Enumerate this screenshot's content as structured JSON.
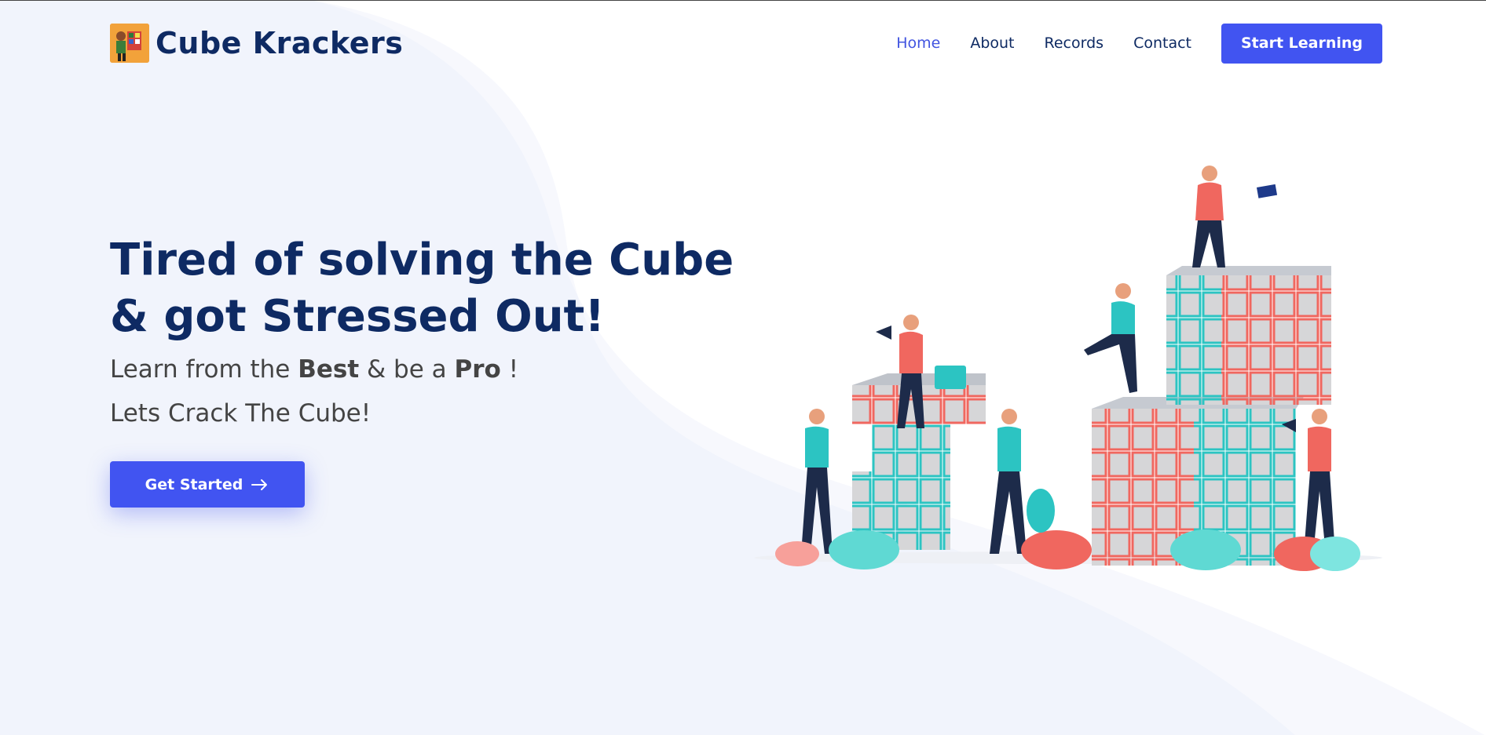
{
  "brand": {
    "name": "Cube Krackers"
  },
  "nav": {
    "items": [
      {
        "label": "Home",
        "active": true
      },
      {
        "label": "About",
        "active": false
      },
      {
        "label": "Records",
        "active": false
      },
      {
        "label": "Contact",
        "active": false
      }
    ],
    "cta": "Start Learning"
  },
  "hero": {
    "title": "Tired of solving the Cube & got Stressed Out!",
    "subtitle_prefix": "Learn from the ",
    "subtitle_best": "Best",
    "subtitle_mid": " & be a ",
    "subtitle_pro": "Pro",
    "subtitle_suffix": " !",
    "tagline": "Lets Crack The Cube!",
    "button_label": "Get Started",
    "button_icon": "arrow-right-icon"
  },
  "colors": {
    "primary": "#4154f1",
    "heading": "#0e2a63",
    "text": "#444444",
    "bg_shape": "#f1f4fc",
    "cube_teal": "#2cc4c2",
    "cube_coral": "#f0675f"
  }
}
